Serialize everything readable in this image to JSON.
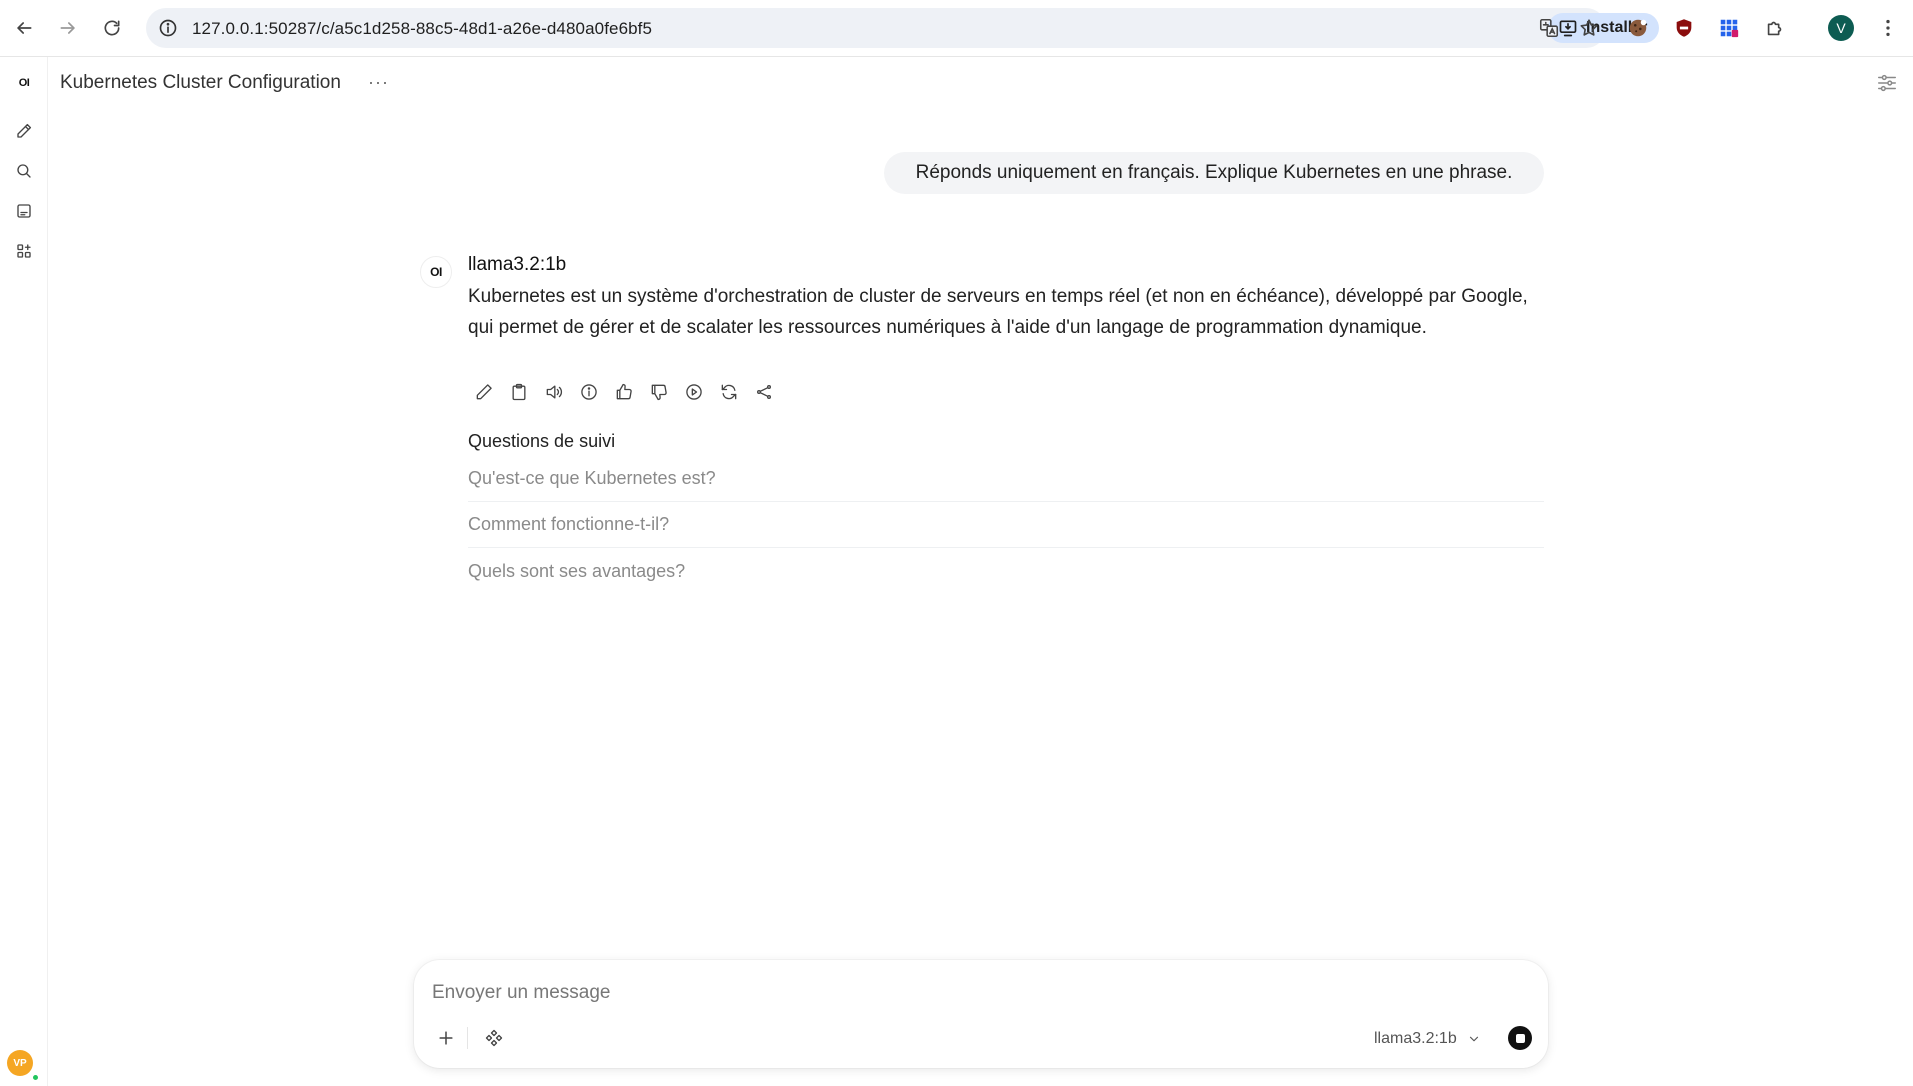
{
  "browser": {
    "url": "127.0.0.1:50287/c/a5c1d258-88c5-48d1-a26e-d480a0fe6bf5",
    "install_label": "Installer",
    "profile_initial": "V"
  },
  "rail": {
    "logo": "OI",
    "user_initials": "VP"
  },
  "header": {
    "title": "Kubernetes Cluster Configuration",
    "menu_glyph": "···"
  },
  "conversation": {
    "user_message": "Réponds uniquement en français. Explique Kubernetes en une phrase.",
    "assistant": {
      "avatar": "OI",
      "model": "llama3.2:1b",
      "response": "Kubernetes est un système d'orchestration de cluster de serveurs en temps réel (et non en échéance), développé par Google, qui permet de gérer et de scalater les ressources numériques à l'aide d'un langage de programmation dynamique."
    },
    "followups_title": "Questions de suivi",
    "followups": [
      "Qu'est-ce que Kubernetes est?",
      "Comment fonctionne-t-il?",
      "Quels sont ses avantages?"
    ]
  },
  "composer": {
    "placeholder": "Envoyer un message",
    "model": "llama3.2:1b"
  },
  "colors": {
    "accent": "#0d5c52",
    "install_bg": "#d3e3fd",
    "bubble_bg": "#f3f4f6",
    "avatar_bg": "#f5a623",
    "online": "#22c55e"
  }
}
